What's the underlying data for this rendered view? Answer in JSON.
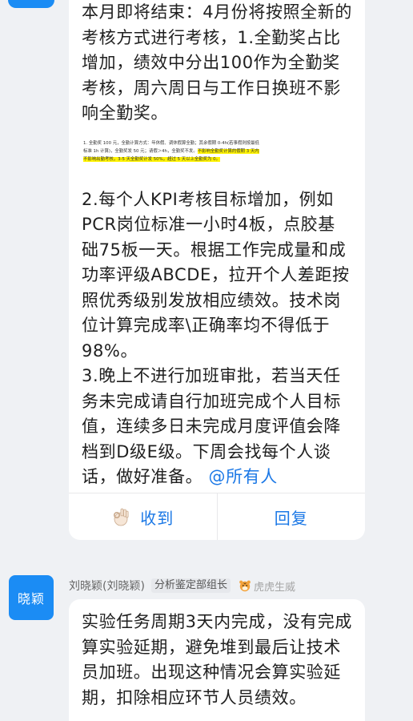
{
  "message1": {
    "paragraph_intro": "本月即将结束：4月份将按照全新的考核方式进行考核，1.全勤奖占比增加，绩效中分出100作为全勤奖考核，周六周日与工作日换班不影响全勤奖。",
    "embedded_image": {
      "line1_plain": "1. 全勤奖 100 元，全勤计算方式：年休假、调休假算全勤；其余假期 0-4h(若事假则按最低",
      "line2_plain": "标准 1h 计算)，全勤奖发 50 元；请假＞4h，全勤奖不发。",
      "line2_highlight": "不影响全勤奖计算的假期 3 天内",
      "line3_highlight": "不影响出勤考核，3-5 天全勤奖计发 50%，超过 5 天以上全勤奖为 0。"
    },
    "paragraph_kpi": "2.每个人KPI考核目标增加，例如PCR岗位标准一小时4板，点胶基础75板一天。根据工作完成量和成功率评级ABCDE，拉开个人差距按照优秀级别发放相应绩效。技术岗位计算完成率\\正确率均不得低于98%。",
    "paragraph_overtime": "3.晚上不进行加班审批，若当天任务未完成请自行加班完成个人目标值，连续多日未完成月度评值会降档到D级E级。下周会找每个人谈话，做好准备。",
    "mention": "@所有人",
    "actions": {
      "receive_label": "收到",
      "reply_label": "回复"
    }
  },
  "message2": {
    "avatar_text": "晓颖",
    "sender_name": "刘晓颖(刘晓颖)",
    "role_tag": "分析鉴定部组长",
    "medal_label": "虎虎生威",
    "text": "实验任务周期3天内完成，没有完成算实验延期，避免堆到最后让技术员加班。出现这种情况会算实验延期，扣除相应环节人员绩效。"
  },
  "colors": {
    "accent": "#1b78e6",
    "avatar": "#1b8cf4",
    "background": "#eff1f4",
    "highlight": "#fff300"
  }
}
